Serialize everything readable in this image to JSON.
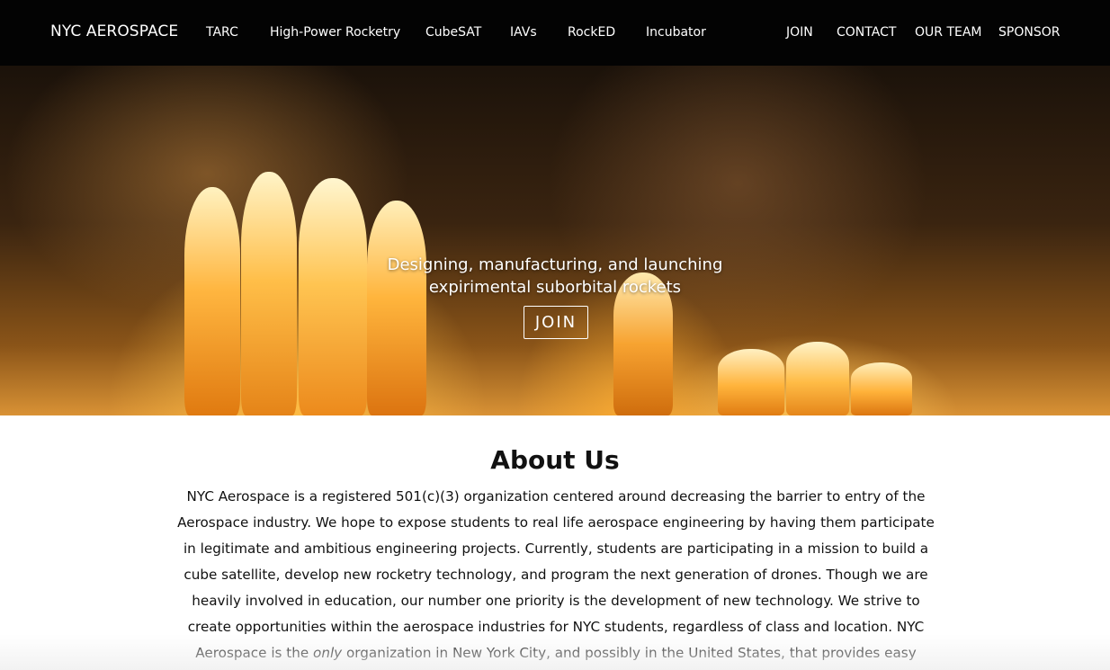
{
  "nav": {
    "brand": "NYC AEROSPACE",
    "links": [
      "TARC",
      "High-Power Rocketry",
      "CubeSAT",
      "IAVs",
      "RockED",
      "Incubator"
    ],
    "right_links": [
      "JOIN",
      "CONTACT",
      "OUR TEAM",
      "SPONSOR"
    ]
  },
  "hero": {
    "tagline_line1": "Designing, manufacturing, and launching",
    "tagline_line2": "expirimental suborbital rockets",
    "button_label": "JOIN"
  },
  "about": {
    "title": "About Us",
    "part1": "NYC Aerospace is a registered 501(c)(3) organization centered around decreasing the barrier to entry of the Aerospace industry. We hope to expose students to real life aerospace engineering by having them participate in legitimate and ambitious engineering projects. Currently, students are participating in a mission to build a cube satellite, develop new rocketry technology, and program the next generation of drones. Though we are heavily involved in education, our number one priority is the development of new technology. We strive to create opportunities within the aerospace industries for NYC students, regardless of class and location. NYC Aerospace is the ",
    "emphasis": "only",
    "part2": " organization in New York City, and possibly in the United States, that provides easy access to resources for young aerospace enthusiasts. We have"
  },
  "colors": {
    "nav_background": "#030303",
    "text": "#111111",
    "flame": "#ffb43c"
  }
}
